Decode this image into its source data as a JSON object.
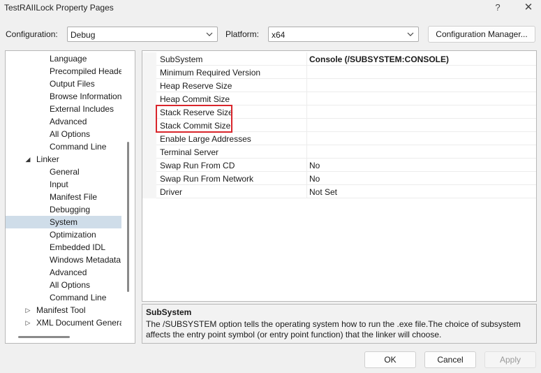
{
  "window": {
    "title": "TestRAIILock Property Pages",
    "help_glyph": "?",
    "close_glyph": "✕"
  },
  "config": {
    "configuration_label": "Configuration:",
    "configuration_value": "Debug",
    "platform_label": "Platform:",
    "platform_value": "x64",
    "manager_button": "Configuration Manager..."
  },
  "tree": {
    "items": [
      {
        "label": "Language",
        "level": 2,
        "expander": ""
      },
      {
        "label": "Precompiled Headers",
        "level": 2,
        "expander": ""
      },
      {
        "label": "Output Files",
        "level": 2,
        "expander": ""
      },
      {
        "label": "Browse Information",
        "level": 2,
        "expander": ""
      },
      {
        "label": "External Includes",
        "level": 2,
        "expander": ""
      },
      {
        "label": "Advanced",
        "level": 2,
        "expander": ""
      },
      {
        "label": "All Options",
        "level": 2,
        "expander": ""
      },
      {
        "label": "Command Line",
        "level": 2,
        "expander": ""
      },
      {
        "label": "Linker",
        "level": 1,
        "expander": "expanded"
      },
      {
        "label": "General",
        "level": 2,
        "expander": ""
      },
      {
        "label": "Input",
        "level": 2,
        "expander": ""
      },
      {
        "label": "Manifest File",
        "level": 2,
        "expander": ""
      },
      {
        "label": "Debugging",
        "level": 2,
        "expander": ""
      },
      {
        "label": "System",
        "level": 2,
        "expander": "",
        "selected": true
      },
      {
        "label": "Optimization",
        "level": 2,
        "expander": ""
      },
      {
        "label": "Embedded IDL",
        "level": 2,
        "expander": ""
      },
      {
        "label": "Windows Metadata",
        "level": 2,
        "expander": ""
      },
      {
        "label": "Advanced",
        "level": 2,
        "expander": ""
      },
      {
        "label": "All Options",
        "level": 2,
        "expander": ""
      },
      {
        "label": "Command Line",
        "level": 2,
        "expander": ""
      },
      {
        "label": "Manifest Tool",
        "level": 1,
        "expander": "collapsed"
      },
      {
        "label": "XML Document Generator",
        "level": 1,
        "expander": "collapsed"
      }
    ]
  },
  "properties": [
    {
      "name": "SubSystem",
      "value": "Console (/SUBSYSTEM:CONSOLE)",
      "bold": true
    },
    {
      "name": "Minimum Required Version",
      "value": ""
    },
    {
      "name": "Heap Reserve Size",
      "value": ""
    },
    {
      "name": "Heap Commit Size",
      "value": ""
    },
    {
      "name": "Stack Reserve Size",
      "value": ""
    },
    {
      "name": "Stack Commit Size",
      "value": ""
    },
    {
      "name": "Enable Large Addresses",
      "value": ""
    },
    {
      "name": "Terminal Server",
      "value": ""
    },
    {
      "name": "Swap Run From CD",
      "value": "No"
    },
    {
      "name": "Swap Run From Network",
      "value": "No"
    },
    {
      "name": "Driver",
      "value": "Not Set"
    }
  ],
  "description": {
    "title": "SubSystem",
    "text": "The /SUBSYSTEM option tells the operating system how to run the .exe file.The choice of subsystem affects the entry point symbol (or entry point function) that the linker will choose."
  },
  "buttons": {
    "ok": "OK",
    "cancel": "Cancel",
    "apply": "Apply"
  },
  "colors": {
    "highlight_box": "#d9262c",
    "selection": "#cfdde9"
  }
}
